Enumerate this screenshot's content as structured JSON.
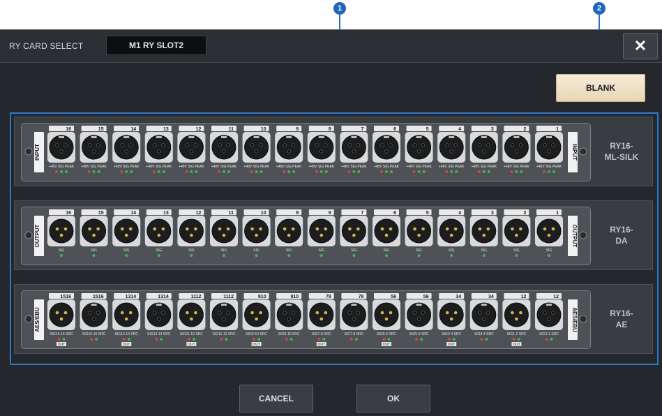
{
  "callouts": {
    "first": "1",
    "second": "2"
  },
  "window": {
    "title": "RY CARD SELECT",
    "slot_label": "M1  RY SLOT2",
    "close_label": "✕",
    "blank_label": "BLANK"
  },
  "cards": [
    {
      "name": "RY16-\nML-SILK",
      "side_label": "INPUT",
      "connector": "female",
      "port_numbers": [
        "16",
        "15",
        "14",
        "13",
        "12",
        "11",
        "10",
        "9",
        "8",
        "7",
        "6",
        "5",
        "4",
        "3",
        "2",
        "1"
      ],
      "indicator_text": "+48V SIG PEAK",
      "indicator_led_colors": [
        "#d64545",
        "#41b64c",
        "#41b64c"
      ]
    },
    {
      "name": "RY16-\nDA",
      "side_label": "OUTPUT",
      "connector": "male",
      "port_numbers": [
        "16",
        "15",
        "14",
        "13",
        "12",
        "11",
        "10",
        "9",
        "8",
        "7",
        "6",
        "5",
        "4",
        "3",
        "2",
        "1"
      ],
      "indicator_text": "SIG",
      "indicator_led_colors": [
        "#41b64c"
      ]
    },
    {
      "name": "RY16-\nAE",
      "side_label": "AES/EBU",
      "connector": "mixed",
      "port_numbers": [
        "15\n16",
        "15\n16",
        "13\n14",
        "13\n14",
        "11\n12",
        "11\n12",
        "9\n10",
        "9\n10",
        "7\n8",
        "7\n8",
        "5\n6",
        "5\n6",
        "3\n4",
        "3\n4",
        "1\n2",
        "1\n2"
      ],
      "aes_labels": [
        "SIG15-16 SRC",
        "SIG15-16 SRC",
        "SIG13-14 SRC",
        "SIG13-14 SRC",
        "SIG11-12 SRC",
        "SIG11-12 SRC",
        "SIG9-10 SRC",
        "SIG9-10 SRC",
        "SIG7-8 SRC",
        "SIG7-8 SRC",
        "SIG5-6 SRC",
        "SIG5-6 SRC",
        "SIG3-4 SRC",
        "SIG3-4 SRC",
        "SIG1-2 SRC",
        "SIG1-2 SRC"
      ],
      "out_label": "OUT",
      "indicator_led_colors": [
        "#d64545",
        "#41b64c"
      ]
    }
  ],
  "footer": {
    "cancel_label": "CANCEL",
    "ok_label": "OK"
  },
  "colors": {
    "accent_blue": "#2d7bd1",
    "blank_button": "#f0e4cc",
    "led_red": "#d64545",
    "led_green": "#41b64c"
  }
}
